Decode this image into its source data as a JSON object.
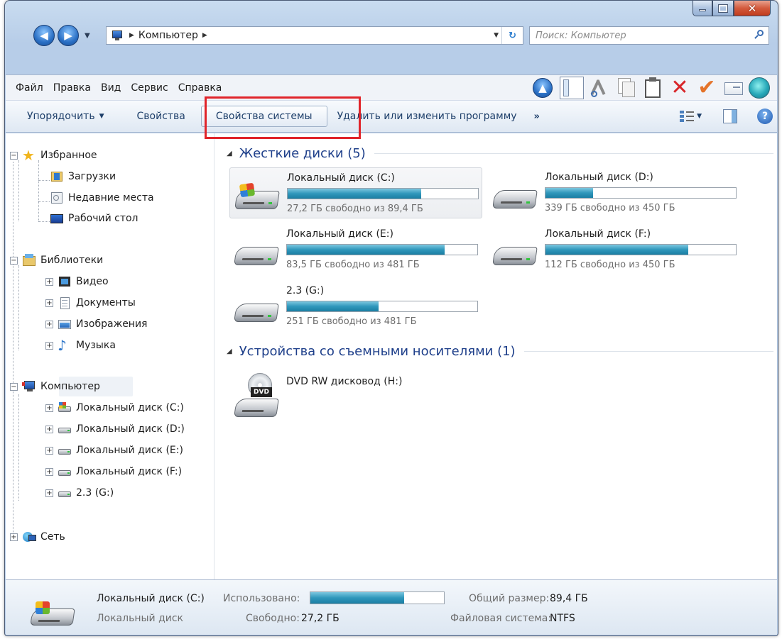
{
  "window": {
    "address": {
      "segments": [
        "Компьютер"
      ]
    },
    "search": {
      "placeholder": "Поиск: Компьютер"
    }
  },
  "menu": [
    "Файл",
    "Правка",
    "Вид",
    "Сервис",
    "Справка"
  ],
  "toolbar_icons": [
    "up-icon",
    "panes-icon",
    "cut-icon",
    "copy-icon",
    "paste-icon",
    "delete-icon",
    "check-icon",
    "properties-icon",
    "shell-icon"
  ],
  "commands": {
    "organize": "Упорядочить",
    "properties": "Свойства",
    "system_properties": "Свойства системы",
    "uninstall": "Удалить или изменить программу",
    "more": "»"
  },
  "nav": {
    "favorites": {
      "label": "Избранное",
      "items": [
        "Загрузки",
        "Недавние места",
        "Рабочий стол"
      ]
    },
    "libraries": {
      "label": "Библиотеки",
      "items": [
        "Видео",
        "Документы",
        "Изображения",
        "Музыка"
      ]
    },
    "computer": {
      "label": "Компьютер",
      "items": [
        "Локальный диск (C:)",
        "Локальный диск (D:)",
        "Локальный диск (E:)",
        "Локальный диск (F:)",
        "2.3 (G:)"
      ]
    },
    "network": {
      "label": "Сеть"
    }
  },
  "groups": {
    "hard_drives": {
      "title": "Жесткие диски (5)",
      "drives": [
        {
          "name": "Локальный диск (C:)",
          "free": "27,2 ГБ свободно из 89,4 ГБ",
          "used_fraction": 0.7
        },
        {
          "name": "Локальный диск (D:)",
          "free": "339 ГБ свободно из 450 ГБ",
          "used_fraction": 0.25
        },
        {
          "name": "Локальный диск (E:)",
          "free": "83,5 ГБ свободно из 481 ГБ",
          "used_fraction": 0.83
        },
        {
          "name": "Локальный диск (F:)",
          "free": "112 ГБ свободно из 450 ГБ",
          "used_fraction": 0.75
        },
        {
          "name": "2.3 (G:)",
          "free": "251 ГБ свободно из 481 ГБ",
          "used_fraction": 0.48
        }
      ]
    },
    "removable": {
      "title": "Устройства со съемными носителями (1)",
      "devices": [
        {
          "name": "DVD RW дисковод (H:)",
          "label": "DVD"
        }
      ]
    }
  },
  "details": {
    "name": "Локальный диск (C:)",
    "type": "Локальный диск",
    "used_label": "Использовано:",
    "used_fraction": 0.7,
    "free_label": "Свободно:",
    "free_value": "27,2 ГБ",
    "size_label": "Общий размер:",
    "size_value": "89,4 ГБ",
    "fs_label": "Файловая система:",
    "fs_value": "NTFS"
  },
  "colors": {
    "accent": "#1e3f8a",
    "highlight_frame": "#e0242a",
    "bar_fill": "#2f97bb"
  }
}
